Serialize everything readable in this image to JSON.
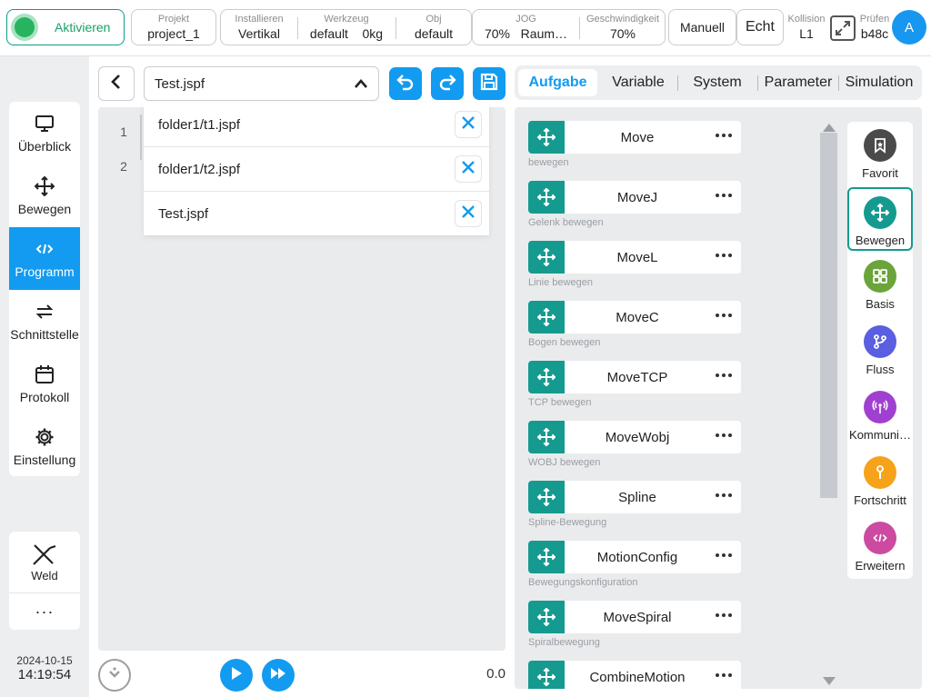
{
  "topbar": {
    "activate_label": "Aktivieren",
    "project": {
      "key": "Projekt",
      "value": "project_1"
    },
    "install": {
      "key": "Installieren",
      "value": "Vertikal"
    },
    "tool": {
      "key": "Werkzeug",
      "value": "default",
      "value2": "0kg"
    },
    "obj": {
      "key": "Obj",
      "value": "default"
    },
    "jog": {
      "key": "JOG",
      "value": "70%",
      "value2": "Raum…"
    },
    "speed": {
      "key": "Geschwindigkeit",
      "value": "70%"
    },
    "mode_label": "Manuell",
    "real_label": "Echt",
    "collision": {
      "key": "Kollision",
      "value": "L1"
    },
    "check": {
      "key": "Prüfen",
      "value": "b48c"
    },
    "avatar_letter": "A"
  },
  "nav": {
    "items": [
      {
        "label": "Überblick",
        "icon": "monitor-icon"
      },
      {
        "label": "Bewegen",
        "icon": "move-icon"
      },
      {
        "label": "Programm",
        "icon": "code-icon",
        "active": true
      },
      {
        "label": "Schnittstelle",
        "icon": "swap-icon"
      },
      {
        "label": "Protokoll",
        "icon": "calendar-icon"
      },
      {
        "label": "Einstellung",
        "icon": "gear-icon"
      }
    ],
    "weld_label": "Weld",
    "more_label": "···",
    "date": "2024-10-15",
    "time": "14:19:54"
  },
  "program": {
    "current_file": "Test.jspf",
    "line_numbers": [
      "1",
      "2"
    ],
    "open_files": [
      "folder1/t1.jspf",
      "folder1/t2.jspf",
      "Test.jspf"
    ],
    "speed_value": "0.0"
  },
  "tabs": [
    "Aufgabe",
    "Variable",
    "System",
    "Parameter",
    "Simulation"
  ],
  "commands": [
    {
      "name": "Move",
      "desc": "bewegen"
    },
    {
      "name": "MoveJ",
      "desc": "Gelenk bewegen"
    },
    {
      "name": "MoveL",
      "desc": "Linie bewegen"
    },
    {
      "name": "MoveC",
      "desc": "Bogen bewegen"
    },
    {
      "name": "MoveTCP",
      "desc": "TCP bewegen"
    },
    {
      "name": "MoveWobj",
      "desc": "WOBJ bewegen"
    },
    {
      "name": "Spline",
      "desc": "Spline-Bewegung"
    },
    {
      "name": "MotionConfig",
      "desc": "Bewegungskonfiguration"
    },
    {
      "name": "MoveSpiral",
      "desc": "Spiralbewegung"
    },
    {
      "name": "CombineMotion",
      "desc": ""
    }
  ],
  "categories": [
    {
      "label": "Favorit",
      "icon": "favorite-icon",
      "color": "#4a4a4a"
    },
    {
      "label": "Bewegen",
      "icon": "move-icon",
      "color": "#159a8f",
      "active": true
    },
    {
      "label": "Basis",
      "icon": "grid-icon",
      "color": "#6aa43a"
    },
    {
      "label": "Fluss",
      "icon": "branch-icon",
      "color": "#5a5ee0"
    },
    {
      "label": "Kommuni…",
      "icon": "antenna-icon",
      "color": "#a040d0"
    },
    {
      "label": "Fortschritt",
      "icon": "wrench-icon",
      "color": "#f7a21b"
    },
    {
      "label": "Erweitern",
      "icon": "code-icon",
      "color": "#cc4aa0"
    }
  ],
  "colors": {
    "accent": "#129bf0",
    "teal": "#159a8f",
    "active_green": "#27b360"
  }
}
